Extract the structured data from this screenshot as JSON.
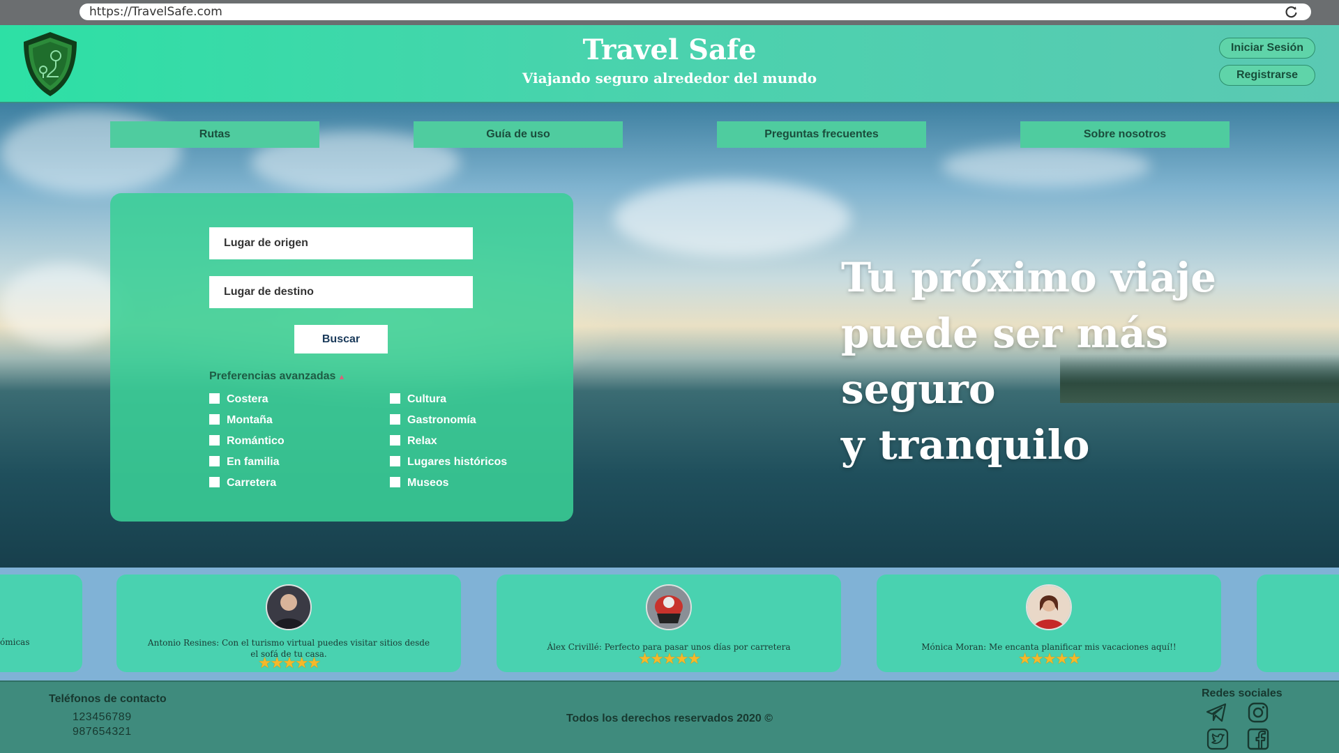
{
  "browser": {
    "url": "https://TravelSafe.com"
  },
  "header": {
    "title": "Travel Safe",
    "subtitle": "Viajando seguro alrededor del mundo",
    "login_label": "Iniciar Sesión",
    "register_label": "Registrarse"
  },
  "nav": {
    "items": [
      {
        "label": "Rutas"
      },
      {
        "label": "Guía de uso"
      },
      {
        "label": "Preguntas frecuentes"
      },
      {
        "label": "Sobre nosotros"
      }
    ]
  },
  "search": {
    "origin_placeholder": "Lugar de origen",
    "destination_placeholder": "Lugar de destino",
    "button_label": "Buscar",
    "advanced_label": "Preferencias avanzadas",
    "options_left": [
      "Costera",
      "Montaña",
      "Romántico",
      "En familia",
      "Carretera"
    ],
    "options_right": [
      "Cultura",
      "Gastronomía",
      "Relax",
      "Lugares históricos",
      "Museos"
    ]
  },
  "hero": {
    "headline_line1": "Tu próximo viaje",
    "headline_line2": "puede ser más seguro",
    "headline_line3": "y tranquilo"
  },
  "testimonials": {
    "partial_left_text": "ómicas",
    "items": [
      {
        "text": "Antonio Resines: Con el turismo virtual puedes visitar sitios desde el sofá de tu casa.",
        "rating": 5,
        "stars": "★★★★★"
      },
      {
        "text": "Álex Crivillé: Perfecto para pasar unos días por carretera",
        "rating": 5,
        "stars": "★★★★★"
      },
      {
        "text": "Mónica Moran: Me encanta planificar mis vacaciones aquí!!",
        "rating": 5,
        "stars": "★★★★★"
      }
    ]
  },
  "footer": {
    "contact_title": "Teléfonos de contacto",
    "phone1": "123456789",
    "phone2": "987654321",
    "rights": "Todos los derechos reservados 2020 ©",
    "social_title": "Redes sociales",
    "social_icons": [
      "telegram-icon",
      "instagram-icon",
      "twitter-icon",
      "facebook-icon"
    ]
  },
  "colors": {
    "header_green": "#2de0a5",
    "panel_green": "#3acf96",
    "nav_green": "#4fcc9f",
    "testimonial_band": "#80b2d6",
    "footer_teal": "#3f8b7d",
    "star_gold": "#f5b82a"
  }
}
